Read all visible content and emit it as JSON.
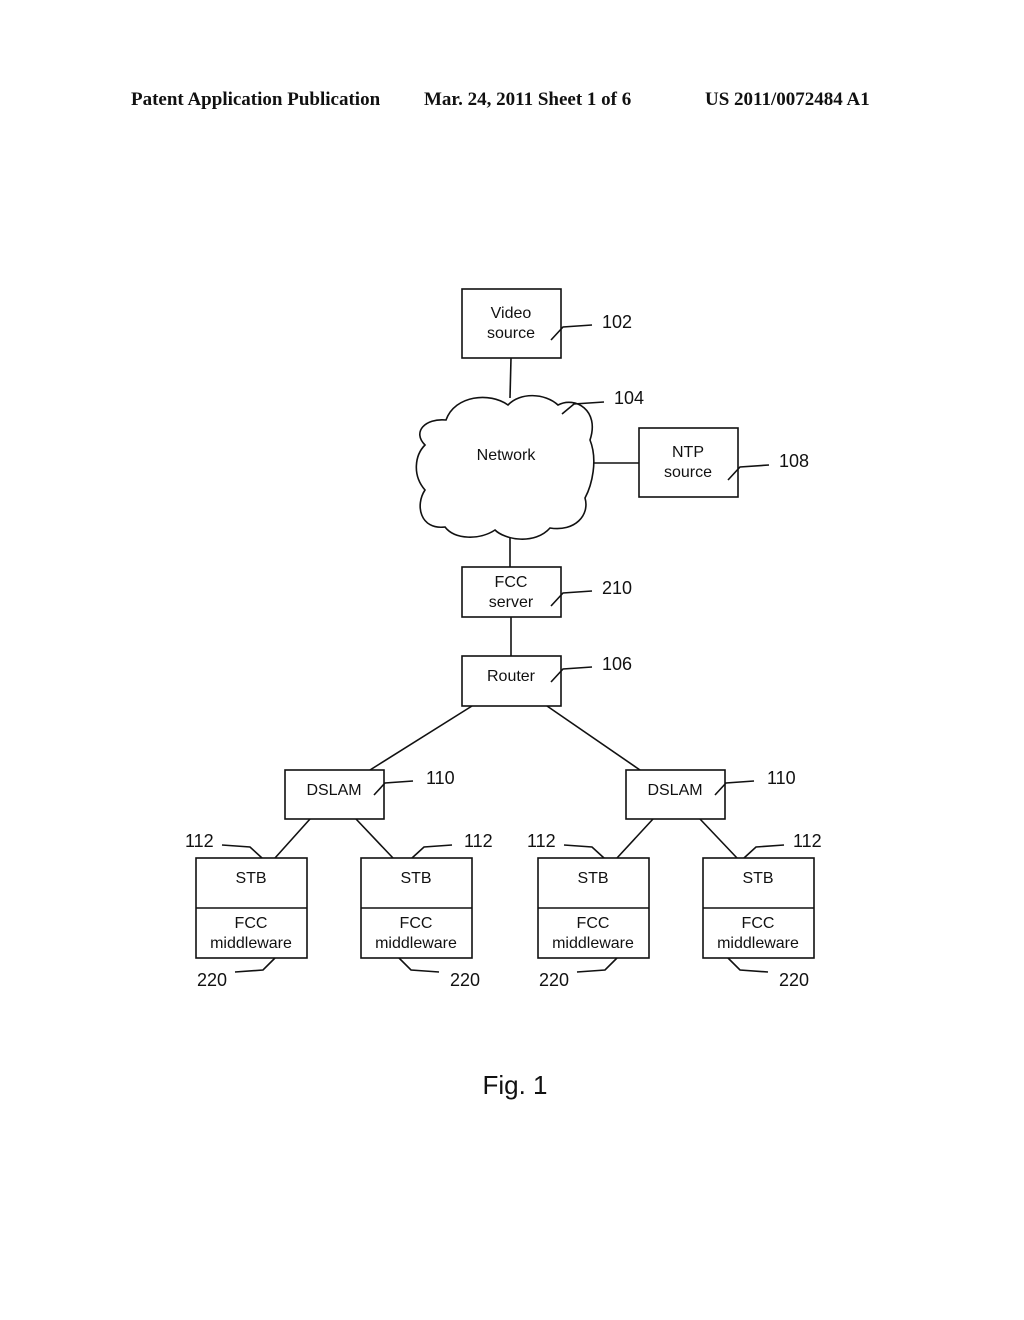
{
  "header": {
    "left": "Patent Application Publication",
    "middle": "Mar. 24, 2011  Sheet 1 of 6",
    "right": "US 2011/0072484 A1"
  },
  "diagram": {
    "video_source": {
      "line1": "Video",
      "line2": "source",
      "ref": "102"
    },
    "network": {
      "label": "Network",
      "ref": "104"
    },
    "ntp_source": {
      "line1": "NTP",
      "line2": "source",
      "ref": "108"
    },
    "fcc_server": {
      "line1": "FCC",
      "line2": "server",
      "ref": "210"
    },
    "router": {
      "label": "Router",
      "ref": "106"
    },
    "dslams": [
      {
        "label": "DSLAM",
        "ref": "110"
      },
      {
        "label": "DSLAM",
        "ref": "110"
      }
    ],
    "stbs": [
      {
        "label": "STB",
        "ref": "112",
        "mw_line1": "FCC",
        "mw_line2": "middleware",
        "mw_ref": "220"
      },
      {
        "label": "STB",
        "ref": "112",
        "mw_line1": "FCC",
        "mw_line2": "middleware",
        "mw_ref": "220"
      },
      {
        "label": "STB",
        "ref": "112",
        "mw_line1": "FCC",
        "mw_line2": "middleware",
        "mw_ref": "220"
      },
      {
        "label": "STB",
        "ref": "112",
        "mw_line1": "FCC",
        "mw_line2": "middleware",
        "mw_ref": "220"
      }
    ]
  },
  "figure_caption": "Fig. 1"
}
